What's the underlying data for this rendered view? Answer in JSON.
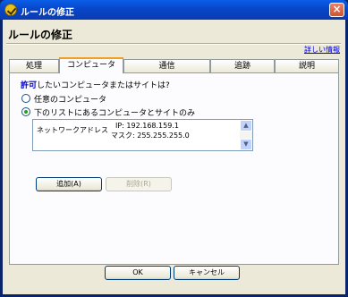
{
  "window": {
    "title": "ルールの修正",
    "close_glyph": "×"
  },
  "dialog": {
    "heading": "ルールの修正",
    "help_link": "詳しい情報"
  },
  "tabs": [
    {
      "label": "処理"
    },
    {
      "label": "コンピュータ",
      "active": true
    },
    {
      "label": "通信"
    },
    {
      "label": "追跡"
    },
    {
      "label": "説明"
    }
  ],
  "panel": {
    "question_highlight": "許可",
    "question_rest": "したいコンピュータまたはサイトは?",
    "options": [
      {
        "label": "任意のコンピュータ",
        "selected": false
      },
      {
        "label": "下のリストにあるコンピュータとサイトのみ",
        "selected": true
      }
    ],
    "list": [
      {
        "type": "ネットワークアドレス",
        "ip": "IP: 192.168.159.1",
        "mask": "マスク: 255.255.255.0"
      }
    ],
    "add_button": "追加(A)",
    "remove_button": "削除(R)"
  },
  "footer": {
    "ok": "OK",
    "cancel": "キャンセル"
  }
}
